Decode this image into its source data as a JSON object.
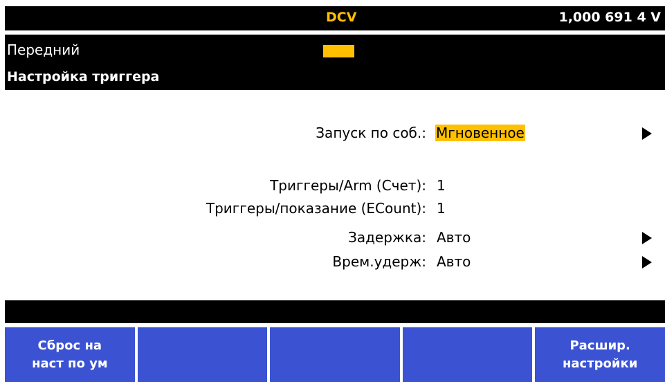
{
  "top_bar": {
    "mode": "DCV",
    "reading": "1,000 691 4 V"
  },
  "header": {
    "terminal": "Передний",
    "screen_title": "Настройка триггера"
  },
  "settings": {
    "trigger_source": {
      "label": "Запуск по соб.:",
      "value": "Мгновенное"
    },
    "triggers_per_arm": {
      "label": "Триггеры/Arm (Счет):",
      "value": "1"
    },
    "triggers_per_reading": {
      "label": "Триггеры/показание (ECount):",
      "value": "1"
    },
    "delay": {
      "label": "Задержка:",
      "value": "Авто"
    },
    "hold_time": {
      "label": "Врем.удерж:",
      "value": "Авто"
    }
  },
  "softkeys": {
    "key1": {
      "line1": "Сброс на",
      "line2": "наст по ум"
    },
    "key2": {
      "line1": "",
      "line2": ""
    },
    "key3": {
      "line1": "",
      "line2": ""
    },
    "key4": {
      "line1": "",
      "line2": ""
    },
    "key5": {
      "line1": "Расшир.",
      "line2": "настройки"
    }
  },
  "colors": {
    "highlight": "#ffc000",
    "softkey_bg": "#3b53d3",
    "bar_bg": "#000000"
  }
}
